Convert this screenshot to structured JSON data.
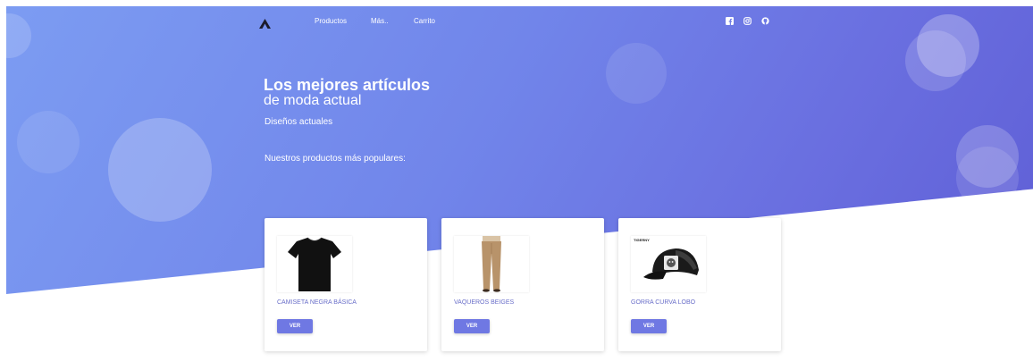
{
  "nav": {
    "links": [
      "Productos",
      "Más..",
      "Carrito"
    ],
    "social_icons": [
      "facebook-icon",
      "instagram-icon",
      "github-icon"
    ]
  },
  "hero": {
    "title": "Los mejores artículos",
    "subtitle": "de moda actual",
    "tagline": "Diseños actuales",
    "popular_label": "Nuestros productos más populares:"
  },
  "products": [
    {
      "name": "CAMISETA NEGRA BÁSICA",
      "button": "VER",
      "image": "black-tshirt"
    },
    {
      "name": "VAQUEROS BEIGES",
      "button": "VER",
      "image": "beige-trousers"
    },
    {
      "name": "GORRA CURVA LOBO",
      "button": "VER",
      "image": "wolf-cap",
      "image_brand": "TIGERNY"
    }
  ],
  "colors": {
    "hero_start": "#7c9cf2",
    "hero_end": "#5f5fd6",
    "accent": "#6f78e3",
    "card_title": "#6a6fc9"
  }
}
